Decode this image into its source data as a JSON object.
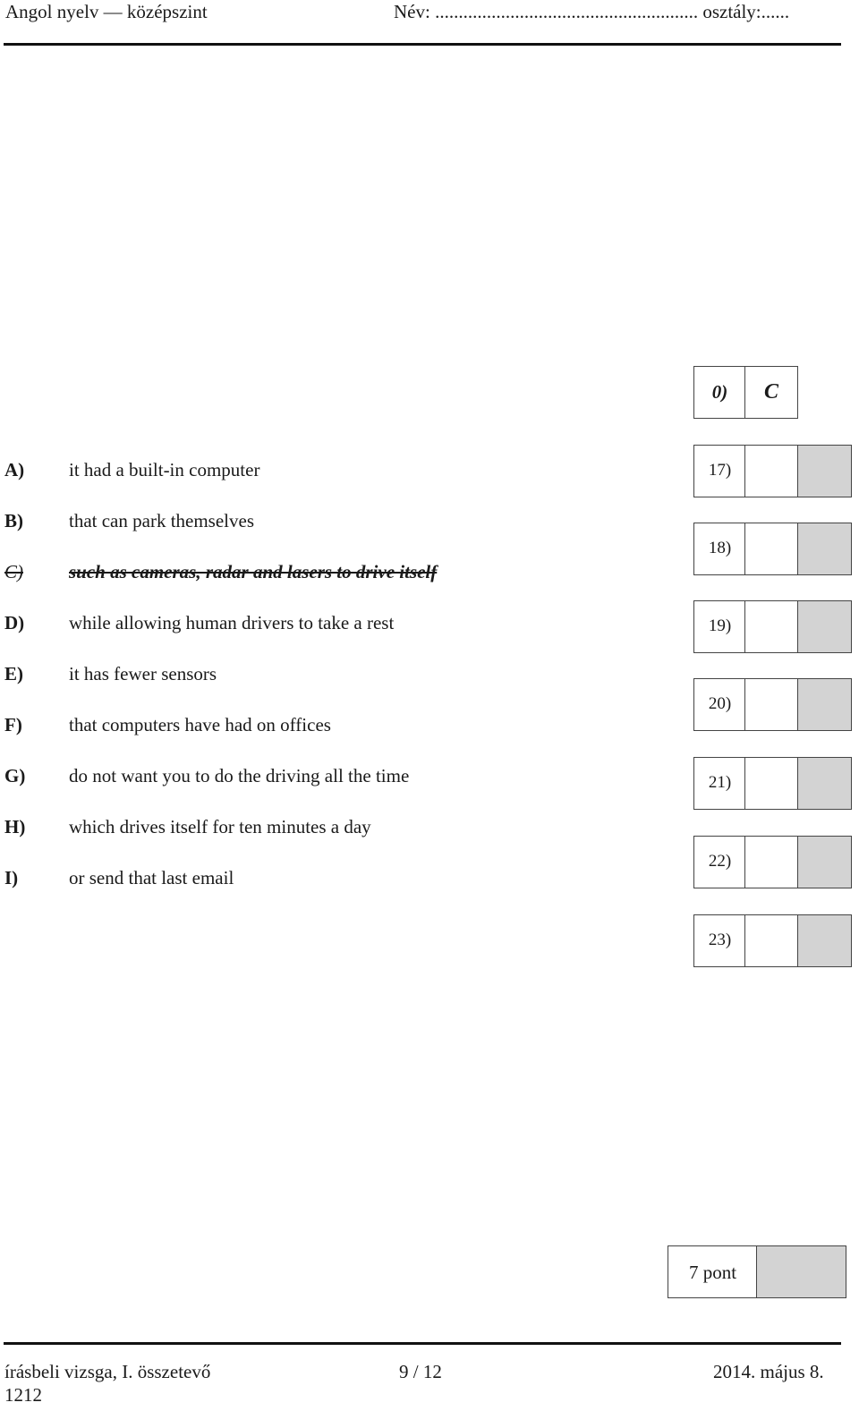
{
  "header": {
    "subject": "Angol nyelv — középszint",
    "name_field": "Név: ........................................................ osztály:......"
  },
  "example": {
    "number": "0)",
    "answer": "C"
  },
  "options": [
    {
      "letter": "A)",
      "text": "it had a built-in computer",
      "struck": false
    },
    {
      "letter": "B)",
      "text": "that can park themselves",
      "struck": false
    },
    {
      "letter": "C)",
      "text": "such as cameras, radar and lasers to drive itself",
      "struck": true
    },
    {
      "letter": "D)",
      "text": "while allowing human drivers to take a rest",
      "struck": false
    },
    {
      "letter": "E)",
      "text": "it has fewer sensors",
      "struck": false
    },
    {
      "letter": "F)",
      "text": "that computers have had on offices",
      "struck": false
    },
    {
      "letter": "G)",
      "text": "do not want you to do the driving all the time",
      "struck": false
    },
    {
      "letter": "H)",
      "text": "which drives itself for ten minutes a day",
      "struck": false
    },
    {
      "letter": "I)",
      "text": "or send that last email",
      "struck": false
    }
  ],
  "answer_rows": [
    {
      "number": "17)",
      "answer": ""
    },
    {
      "number": "18)",
      "answer": ""
    },
    {
      "number": "19)",
      "answer": ""
    },
    {
      "number": "20)",
      "answer": ""
    },
    {
      "number": "21)",
      "answer": ""
    },
    {
      "number": "22)",
      "answer": ""
    },
    {
      "number": "23)",
      "answer": ""
    }
  ],
  "score": {
    "label": "7 pont"
  },
  "footer": {
    "left": "írásbeli vizsga, I. összetevő",
    "center": "9 / 12",
    "right": "2014. május 8.",
    "code": "1212"
  }
}
